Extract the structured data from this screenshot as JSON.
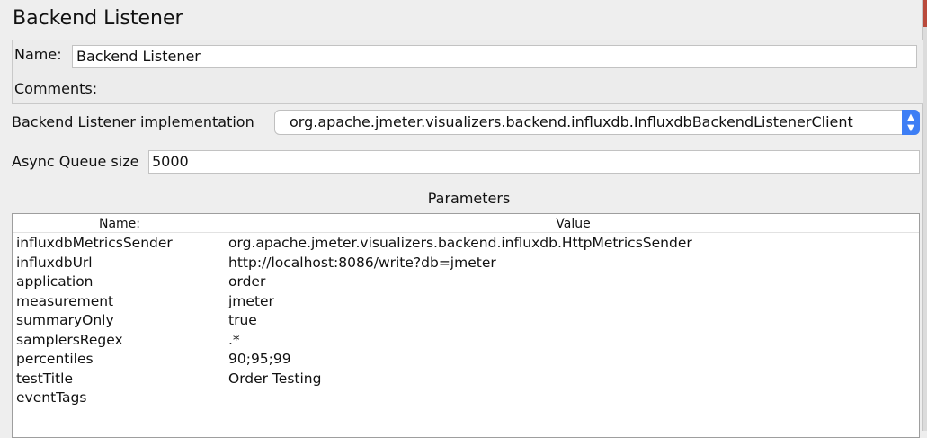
{
  "window": {
    "title": "Backend Listener"
  },
  "name_field": {
    "label": "Name:",
    "value": "Backend Listener"
  },
  "comments": {
    "label": "Comments:"
  },
  "implementation": {
    "label": "Backend Listener implementation",
    "selected": "org.apache.jmeter.visualizers.backend.influxdb.InfluxdbBackendListenerClient"
  },
  "async_queue": {
    "label": "Async Queue size",
    "value": "5000"
  },
  "parameters": {
    "title": "Parameters",
    "columns": [
      "Name:",
      "Value"
    ],
    "rows": [
      {
        "name": "influxdbMetricsSender",
        "value": "org.apache.jmeter.visualizers.backend.influxdb.HttpMetricsSender"
      },
      {
        "name": "influxdbUrl",
        "value": "http://localhost:8086/write?db=jmeter"
      },
      {
        "name": "application",
        "value": "order"
      },
      {
        "name": "measurement",
        "value": "jmeter"
      },
      {
        "name": "summaryOnly",
        "value": "true"
      },
      {
        "name": "samplersRegex",
        "value": ".*"
      },
      {
        "name": "percentiles",
        "value": "90;95;99"
      },
      {
        "name": "testTitle",
        "value": "Order Testing"
      },
      {
        "name": "eventTags",
        "value": ""
      }
    ]
  },
  "colors": {
    "select_accent": "#3d7ef5",
    "background": "#eeeeee"
  },
  "icons": {
    "select_arrows": "updown-arrows-icon"
  }
}
